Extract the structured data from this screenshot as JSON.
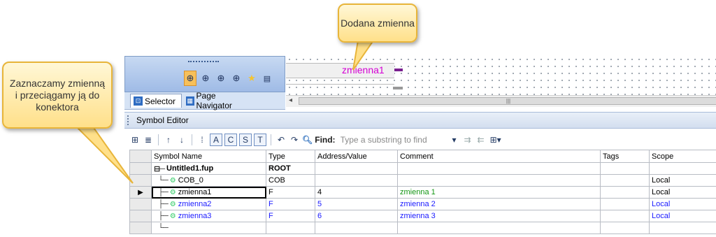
{
  "callouts": {
    "top": "Dodana zmienna",
    "left": "Zaznaczamy zmienną i przeciągamy ją do konektora"
  },
  "canvas": {
    "variable_label": "zmienna1"
  },
  "tabs": [
    {
      "label": "Selector"
    },
    {
      "label": "Page Navigator"
    }
  ],
  "symbol_editor": {
    "title": "Symbol Editor",
    "toolbar": {
      "buttons": [
        "A",
        "C",
        "S",
        "T"
      ],
      "find_label": "Find:",
      "find_placeholder": "Type a substring to find"
    },
    "columns": [
      "Symbol Name",
      "Type",
      "Address/Value",
      "Comment",
      "Tags",
      "Scope"
    ],
    "rows": [
      {
        "name": "Untitled1.fup",
        "type": "ROOT",
        "address": "",
        "comment": "",
        "tags": "",
        "scope": ""
      },
      {
        "name": "COB_0",
        "type": "COB",
        "address": "",
        "comment": "",
        "tags": "",
        "scope": "Local"
      },
      {
        "name": "zmienna1",
        "type": "F",
        "address": "4",
        "comment": "zmienna 1",
        "tags": "",
        "scope": "Local"
      },
      {
        "name": "zmienna2",
        "type": "F",
        "address": "5",
        "comment": "zmienna 2",
        "tags": "",
        "scope": "Local"
      },
      {
        "name": "zmienna3",
        "type": "F",
        "address": "6",
        "comment": "zmienna 3",
        "tags": "",
        "scope": "Local"
      }
    ]
  },
  "colors": {
    "variable_magenta": "#d400d4",
    "callout_fill": "#ffe08a",
    "selected_row_text": "#1a1aff",
    "comment_green": "#149614"
  }
}
